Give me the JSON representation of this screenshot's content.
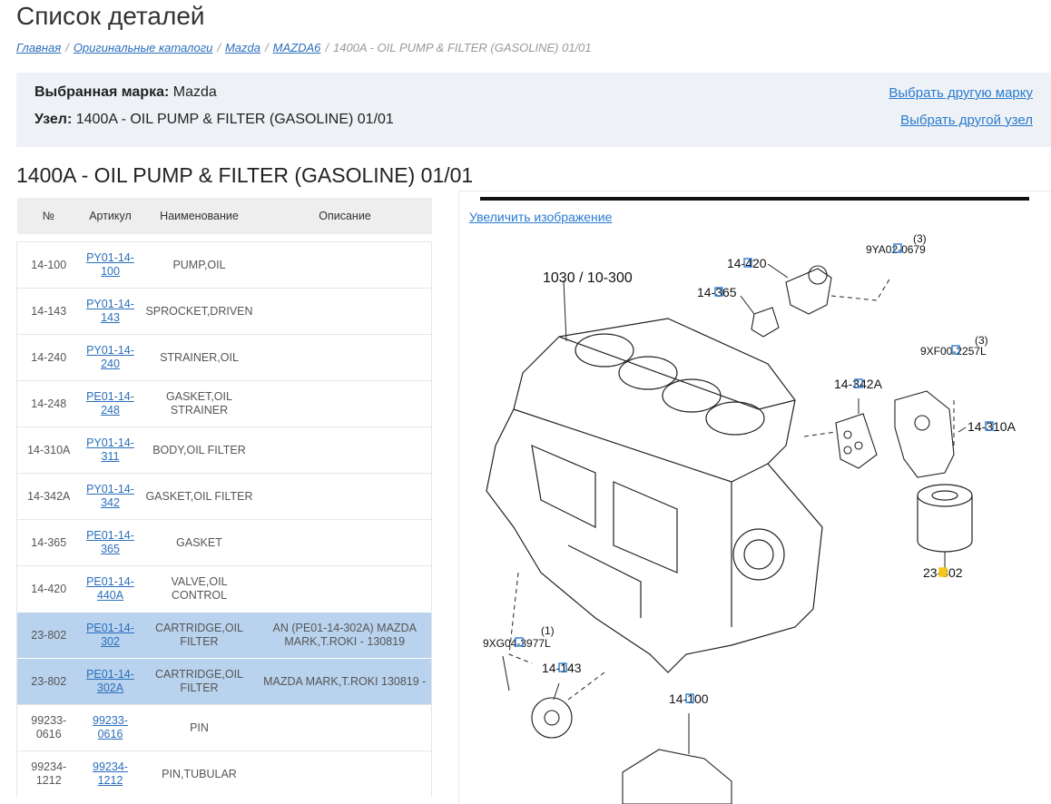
{
  "page": {
    "title": "Список деталей"
  },
  "breadcrumb": {
    "items": [
      "Главная",
      "Оригинальные каталоги",
      "Mazda",
      "MAZDA6"
    ],
    "separator": "/",
    "current": "1400A - OIL PUMP & FILTER (GASOLINE) 01/01"
  },
  "info": {
    "brand_label": "Выбранная марка:",
    "brand_value": "Mazda",
    "node_label": "Узел:",
    "node_value": "1400A - OIL PUMP & FILTER (GASOLINE) 01/01",
    "change_brand_link": "Выбрать другую марку",
    "change_node_link": "Выбрать другой узел"
  },
  "section": {
    "title": "1400A - OIL PUMP & FILTER (GASOLINE) 01/01"
  },
  "table": {
    "headers": [
      "№",
      "Артикул",
      "Наименование",
      "Описание"
    ],
    "rows": [
      {
        "num": "14-100",
        "article": "PY01-14-100",
        "name": "PUMP,OIL",
        "desc": "",
        "highlight": false
      },
      {
        "num": "14-143",
        "article": "PY01-14-143",
        "name": "SPROCKET,DRIVEN",
        "desc": "",
        "highlight": false
      },
      {
        "num": "14-240",
        "article": "PY01-14-240",
        "name": "STRAINER,OIL",
        "desc": "",
        "highlight": false
      },
      {
        "num": "14-248",
        "article": "PE01-14-248",
        "name": "GASKET,OIL STRAINER",
        "desc": "",
        "highlight": false
      },
      {
        "num": "14-310A",
        "article": "PY01-14-311",
        "name": "BODY,OIL FILTER",
        "desc": "",
        "highlight": false
      },
      {
        "num": "14-342A",
        "article": "PY01-14-342",
        "name": "GASKET,OIL FILTER",
        "desc": "",
        "highlight": false
      },
      {
        "num": "14-365",
        "article": "PE01-14-365",
        "name": "GASKET",
        "desc": "",
        "highlight": false
      },
      {
        "num": "14-420",
        "article": "PE01-14-440A",
        "name": "VALVE,OIL CONTROL",
        "desc": "",
        "highlight": false
      },
      {
        "num": "23-802",
        "article": "PE01-14-302",
        "name": "CARTRIDGE,OIL FILTER",
        "desc": "AN (PE01-14-302A) MAZDA MARK,T.ROKI - 130819",
        "highlight": true
      },
      {
        "num": "23-802",
        "article": "PE01-14-302A",
        "name": "CARTRIDGE,OIL FILTER",
        "desc": "MAZDA MARK,T.ROKI 130819 -",
        "highlight": true
      },
      {
        "num": "99233-0616",
        "article": "99233-0616",
        "name": "PIN",
        "desc": "",
        "highlight": false
      },
      {
        "num": "99234-1212",
        "article": "99234-1212",
        "name": "PIN,TUBULAR",
        "desc": "",
        "highlight": false
      }
    ]
  },
  "diagram": {
    "zoom_link": "Увеличить изображение",
    "callouts": {
      "block_ref": "1030 / 10-300",
      "c_14420": "14-420",
      "c_9ya": "9YA02-0679",
      "c_9ya_qty": "(3)",
      "c_14365": "14-365",
      "c_9xf": "9XF00-2257L",
      "c_9xf_qty": "(3)",
      "c_14342a": "14-342A",
      "c_14310a": "14-310A",
      "c_23802": "23-802",
      "c_9xg": "9XG04-3977L",
      "c_9xg_qty": "(1)",
      "c_14143": "14-143",
      "c_14100": "14-100"
    }
  },
  "colors": {
    "link": "#2a6ebb",
    "highlight_row": "#b9d3ee",
    "info_bg": "#eef2f6",
    "callout_box": "#2a7bd0",
    "callout_selected": "#f5c518"
  }
}
